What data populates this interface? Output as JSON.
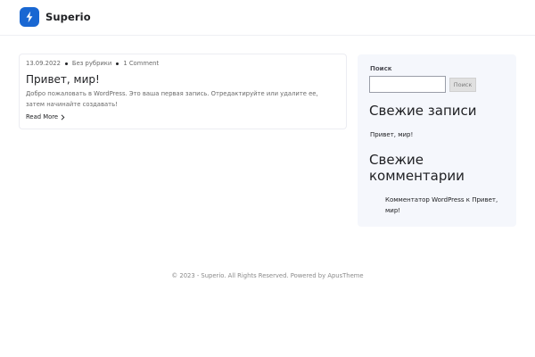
{
  "header": {
    "logo_text": "Superio",
    "logo_icon": "bolt-icon",
    "brand_color": "#1967d2"
  },
  "post": {
    "date": "13.09.2022",
    "category": "Без рубрики",
    "comments": "1 Comment",
    "title": "Привет, мир!",
    "excerpt": "Добро пожаловать в WordPress. Это ваша первая запись. Отредактируйте или удалите ее, затем начинайте создавать!",
    "read_more": "Read More",
    "read_more_icon": "chevron-right-icon"
  },
  "sidebar": {
    "search_label": "Поиск",
    "search_value": "",
    "search_button": "Поиск",
    "recent_posts_title": "Свежие записи",
    "recent_posts": [
      "Привет, мир!"
    ],
    "recent_comments_title": "Свежие комментарии",
    "recent_comment_author": "Комментатор WordPress",
    "recent_comment_on": "к",
    "recent_comment_post": "Привет, мир!"
  },
  "footer": {
    "prefix": "© 2023 - Superio. All Rights Reserved. Powered by",
    "powered_link": "ApusTheme"
  }
}
